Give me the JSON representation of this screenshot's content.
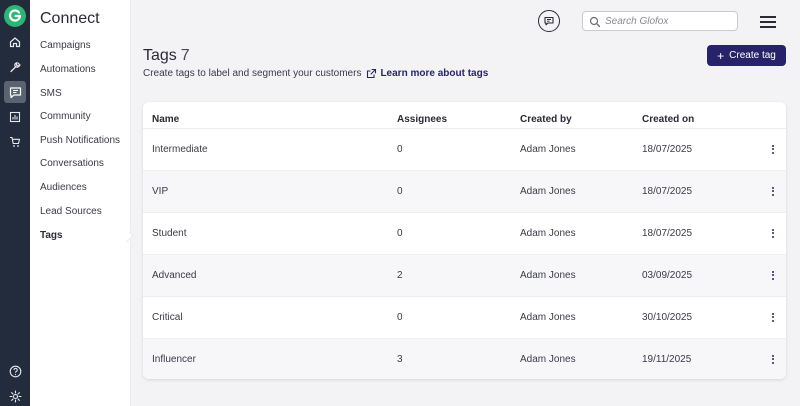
{
  "nav_rail": {
    "items": [
      {
        "icon": "home-icon"
      },
      {
        "icon": "wrench-icon"
      },
      {
        "icon": "connect-icon",
        "active": true
      },
      {
        "icon": "reports-icon"
      },
      {
        "icon": "cart-icon"
      }
    ],
    "bottom": [
      {
        "icon": "help-icon"
      },
      {
        "icon": "settings-icon"
      }
    ],
    "brand_color": "#2bb673"
  },
  "sidebar": {
    "title": "Connect",
    "items": [
      {
        "label": "Campaigns"
      },
      {
        "label": "Automations"
      },
      {
        "label": "SMS"
      },
      {
        "label": "Community"
      },
      {
        "label": "Push Notifications"
      },
      {
        "label": "Conversations"
      },
      {
        "label": "Audiences"
      },
      {
        "label": "Lead Sources"
      },
      {
        "label": "Tags",
        "active": true
      }
    ]
  },
  "header": {
    "search_placeholder": "Search Glofox"
  },
  "page": {
    "title": "Tags",
    "count": "7",
    "subtitle": "Create tags to label and segment your customers",
    "learn_more": "Learn more about tags",
    "create_button": "Create tag",
    "accent_color": "#27236b"
  },
  "table": {
    "columns": [
      "Name",
      "Assignees",
      "Created by",
      "Created on"
    ],
    "rows": [
      {
        "name": "Intermediate",
        "assignees": "0",
        "created_by": "Adam Jones",
        "created_on": "18/07/2025"
      },
      {
        "name": "VIP",
        "assignees": "0",
        "created_by": "Adam Jones",
        "created_on": "18/07/2025"
      },
      {
        "name": "Student",
        "assignees": "0",
        "created_by": "Adam Jones",
        "created_on": "18/07/2025"
      },
      {
        "name": "Advanced",
        "assignees": "2",
        "created_by": "Adam Jones",
        "created_on": "03/09/2025"
      },
      {
        "name": "Critical",
        "assignees": "0",
        "created_by": "Adam Jones",
        "created_on": "30/10/2025"
      },
      {
        "name": "Influencer",
        "assignees": "3",
        "created_by": "Adam Jones",
        "created_on": "19/11/2025"
      }
    ]
  }
}
